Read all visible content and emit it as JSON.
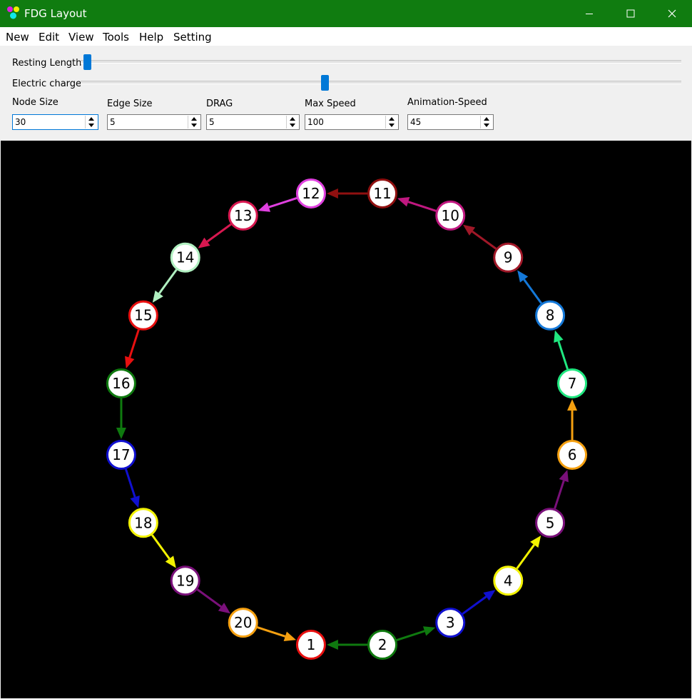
{
  "window": {
    "title": "FDG Layout"
  },
  "menu": [
    {
      "label": "New"
    },
    {
      "label": "Edit"
    },
    {
      "label": "View"
    },
    {
      "label": "Tools"
    },
    {
      "label": "Help"
    },
    {
      "label": "Setting"
    }
  ],
  "sliders": {
    "resting_length": {
      "label": "Resting Length",
      "value_fraction": 0.0
    },
    "electric_charge": {
      "label": "Electric charge",
      "value_fraction": 0.405
    }
  },
  "fields": [
    {
      "label": "Node Size",
      "value": "30"
    },
    {
      "label": "Edge Size",
      "value": "5"
    },
    {
      "label": "DRAG",
      "value": "5"
    },
    {
      "label": "Max Speed",
      "value": "100"
    },
    {
      "label": "Animation-Speed",
      "value": "45"
    }
  ],
  "graph": {
    "nodes": [
      {
        "id": "1",
        "color": "#e81010"
      },
      {
        "id": "2",
        "color": "#0f7a0f"
      },
      {
        "id": "3",
        "color": "#1010d0"
      },
      {
        "id": "4",
        "color": "#f2f200"
      },
      {
        "id": "5",
        "color": "#7a107a"
      },
      {
        "id": "6",
        "color": "#f5a010"
      },
      {
        "id": "7",
        "color": "#20e880"
      },
      {
        "id": "8",
        "color": "#1478d8"
      },
      {
        "id": "9",
        "color": "#a01828"
      },
      {
        "id": "10",
        "color": "#c01880"
      },
      {
        "id": "11",
        "color": "#901010"
      },
      {
        "id": "12",
        "color": "#e040e0"
      },
      {
        "id": "13",
        "color": "#d81850"
      },
      {
        "id": "14",
        "color": "#b0f0c0"
      },
      {
        "id": "15",
        "color": "#e81010"
      },
      {
        "id": "16",
        "color": "#0f7a0f"
      },
      {
        "id": "17",
        "color": "#1010d0"
      },
      {
        "id": "18",
        "color": "#f2f200"
      },
      {
        "id": "19",
        "color": "#7a107a"
      },
      {
        "id": "20",
        "color": "#f5a010"
      }
    ],
    "edges": [
      {
        "from": "2",
        "to": "1",
        "color": "#0f7a0f"
      },
      {
        "from": "2",
        "to": "3",
        "color": "#0f7a0f"
      },
      {
        "from": "3",
        "to": "4",
        "color": "#1010d0"
      },
      {
        "from": "4",
        "to": "5",
        "color": "#f2f200"
      },
      {
        "from": "5",
        "to": "6",
        "color": "#7a107a"
      },
      {
        "from": "6",
        "to": "7",
        "color": "#f5a010"
      },
      {
        "from": "7",
        "to": "8",
        "color": "#20e880"
      },
      {
        "from": "8",
        "to": "9",
        "color": "#1478d8"
      },
      {
        "from": "9",
        "to": "10",
        "color": "#a01828"
      },
      {
        "from": "10",
        "to": "11",
        "color": "#c01880"
      },
      {
        "from": "11",
        "to": "12",
        "color": "#901010"
      },
      {
        "from": "12",
        "to": "13",
        "color": "#e040e0"
      },
      {
        "from": "13",
        "to": "14",
        "color": "#d81850"
      },
      {
        "from": "14",
        "to": "15",
        "color": "#b0f0c0"
      },
      {
        "from": "15",
        "to": "16",
        "color": "#e81010"
      },
      {
        "from": "16",
        "to": "17",
        "color": "#0f7a0f"
      },
      {
        "from": "17",
        "to": "18",
        "color": "#1010d0"
      },
      {
        "from": "18",
        "to": "19",
        "color": "#f2f200"
      },
      {
        "from": "19",
        "to": "20",
        "color": "#7a107a"
      },
      {
        "from": "20",
        "to": "1",
        "color": "#f5a010"
      }
    ]
  }
}
